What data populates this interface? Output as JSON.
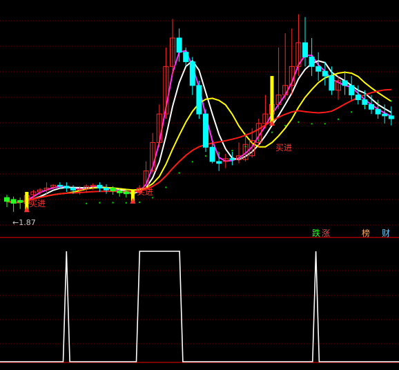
{
  "colors": {
    "background": "#000000",
    "grid": "#6e0000",
    "divider": "#c00000",
    "candle_up": "#ff2a2a",
    "candle_down": "#00ffff",
    "candle_green": "#22ff22",
    "ma_white": "#ffffff",
    "ma_magenta": "#ff33ff",
    "ma_yellow": "#ffff00",
    "ma_red": "#ff1a1a",
    "dots_green": "#00cc00",
    "signal_bar": "#ffff00",
    "signal_text": "#ff3333",
    "indicator_line": "#ffffff"
  },
  "chart_data": [
    {
      "type": "candlestick",
      "x": [
        0,
        1,
        2,
        3,
        4,
        5,
        6,
        7,
        8,
        9,
        10,
        11,
        12,
        13,
        14,
        15,
        16,
        17,
        18,
        19,
        20,
        21,
        22,
        23,
        24,
        25,
        26,
        27,
        28,
        29,
        30,
        31,
        32,
        33,
        34,
        35,
        36,
        37,
        38,
        39,
        40,
        41,
        42,
        43,
        44,
        45,
        46,
        47,
        48,
        49,
        50,
        51,
        52,
        53,
        54,
        55,
        56,
        57,
        58,
        59,
        60,
        61,
        62,
        63,
        64,
        65,
        66,
        67,
        68,
        69,
        70,
        71,
        72
      ],
      "candles": {
        "open": [
          2.02,
          2.0,
          1.99,
          1.96,
          2.05,
          2.08,
          2.1,
          2.13,
          2.15,
          2.14,
          2.12,
          2.1,
          2.11,
          2.14,
          2.15,
          2.12,
          2.12,
          2.09,
          2.08,
          2.07,
          2.08,
          2.12,
          2.3,
          2.6,
          2.9,
          3.4,
          3.7,
          3.55,
          3.45,
          3.2,
          2.9,
          2.55,
          2.4,
          2.4,
          2.43,
          2.42,
          2.42,
          2.46,
          2.6,
          2.8,
          2.9,
          3.0,
          3.1,
          3.2,
          3.4,
          3.65,
          3.5,
          3.4,
          3.35,
          3.3,
          3.15,
          3.25,
          3.2,
          3.1,
          3.05,
          3.0,
          2.95,
          2.9,
          2.88
        ],
        "high": [
          2.05,
          2.03,
          2.02,
          2.08,
          2.1,
          2.12,
          2.18,
          2.16,
          2.18,
          2.18,
          2.15,
          2.14,
          2.16,
          2.17,
          2.18,
          2.16,
          2.14,
          2.12,
          2.1,
          2.1,
          2.15,
          2.4,
          2.7,
          3.0,
          3.6,
          3.9,
          3.8,
          3.6,
          3.5,
          3.25,
          2.95,
          2.6,
          2.5,
          2.48,
          2.5,
          2.6,
          2.7,
          2.75,
          2.85,
          3.1,
          3.3,
          3.6,
          3.75,
          3.8,
          3.95,
          3.92,
          3.7,
          3.55,
          3.45,
          3.4,
          3.3,
          3.35,
          3.3,
          3.2,
          3.15,
          3.1,
          3.05,
          3.0,
          2.98
        ],
        "low": [
          1.92,
          1.87,
          1.9,
          1.94,
          2.0,
          2.05,
          2.06,
          2.1,
          2.11,
          2.08,
          2.06,
          2.05,
          2.07,
          2.1,
          2.08,
          2.06,
          2.05,
          2.03,
          2.02,
          2.03,
          2.05,
          2.1,
          2.28,
          2.55,
          2.85,
          3.3,
          3.45,
          3.4,
          3.1,
          2.85,
          2.5,
          2.38,
          2.3,
          2.33,
          2.36,
          2.38,
          2.4,
          2.44,
          2.55,
          2.75,
          2.85,
          2.95,
          3.05,
          3.1,
          3.3,
          3.4,
          3.3,
          3.25,
          3.2,
          3.1,
          3.05,
          3.1,
          3.05,
          3.0,
          2.95,
          2.9,
          2.85,
          2.8,
          2.78
        ],
        "close": [
          1.98,
          1.96,
          1.97,
          2.04,
          2.08,
          2.1,
          2.12,
          2.15,
          2.14,
          2.12,
          2.1,
          2.11,
          2.14,
          2.15,
          2.12,
          2.1,
          2.09,
          2.07,
          2.06,
          2.06,
          2.12,
          2.3,
          2.6,
          2.9,
          3.4,
          3.7,
          3.55,
          3.45,
          3.2,
          2.9,
          2.55,
          2.4,
          2.38,
          2.43,
          2.42,
          2.46,
          2.58,
          2.62,
          2.8,
          2.9,
          3.0,
          3.1,
          3.2,
          3.4,
          3.65,
          3.5,
          3.4,
          3.35,
          3.3,
          3.15,
          3.25,
          3.2,
          3.1,
          3.05,
          3.0,
          2.95,
          2.9,
          2.88,
          2.85
        ]
      },
      "annotations": [
        {
          "text": "买进",
          "kind": "buy-signal"
        },
        {
          "text": "买进",
          "kind": "buy-signal"
        },
        {
          "text": "买进",
          "kind": "buy-signal"
        },
        {
          "text": "←1.87",
          "kind": "low-marker"
        }
      ]
    },
    {
      "type": "line",
      "x": [
        0,
        1,
        2,
        3,
        4,
        5,
        6,
        7,
        8,
        9,
        10,
        11,
        12,
        13,
        14,
        15,
        16,
        17,
        18,
        19,
        20,
        21,
        22,
        23,
        24,
        25,
        26,
        27,
        28,
        29,
        30,
        31,
        32,
        33,
        34,
        35,
        36,
        37,
        38,
        39,
        40,
        41,
        42,
        43,
        44,
        45,
        46,
        47,
        48,
        49,
        50,
        51,
        52,
        53,
        54,
        55,
        56,
        57,
        58,
        59,
        60,
        61,
        62,
        63,
        64,
        65,
        66,
        67,
        68,
        69,
        70,
        71,
        72,
        73,
        74,
        75,
        76,
        77,
        78,
        79,
        80,
        81,
        82,
        83,
        84,
        85,
        86,
        87,
        88,
        89,
        90,
        91,
        92,
        93,
        94,
        95,
        96,
        97,
        98,
        99,
        100,
        101,
        102,
        103,
        104,
        105,
        106,
        107,
        108,
        109,
        110,
        111,
        112,
        113,
        114,
        115,
        116,
        117,
        118,
        119,
        120
      ],
      "values": [
        0,
        0,
        0,
        0,
        0,
        0,
        0,
        0,
        0,
        0,
        0,
        0,
        0,
        0,
        0,
        0,
        0,
        0,
        0,
        0,
        1,
        0,
        0,
        0,
        0,
        0,
        0,
        0,
        0,
        0,
        0,
        0,
        0,
        0,
        0,
        0,
        0,
        0,
        0,
        0,
        0,
        0,
        1,
        1,
        1,
        1,
        1,
        1,
        1,
        1,
        1,
        1,
        1,
        1,
        1,
        0,
        0,
        0,
        0,
        0,
        0,
        0,
        0,
        0,
        0,
        0,
        0,
        0,
        0,
        0,
        0,
        0,
        0,
        0,
        0,
        0,
        0,
        0,
        0,
        0,
        0,
        0,
        0,
        0,
        0,
        0,
        0,
        0,
        0,
        0,
        0,
        0,
        0,
        0,
        0,
        1,
        0,
        0,
        0,
        0,
        0,
        0,
        0,
        0,
        0,
        0,
        0,
        0,
        0,
        0,
        0,
        0,
        0,
        0,
        0,
        0,
        0,
        0,
        0,
        0,
        0
      ],
      "series_labels": [
        "跌",
        "涨",
        "榜",
        "财"
      ]
    }
  ]
}
